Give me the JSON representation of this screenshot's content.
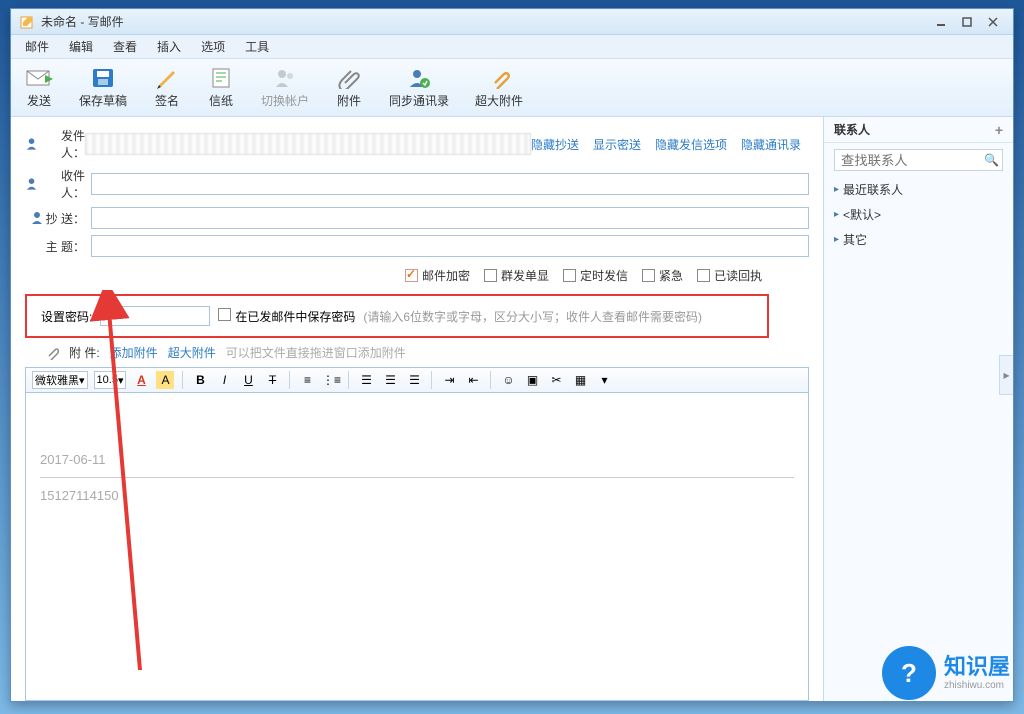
{
  "window": {
    "title": "未命名 - 写邮件"
  },
  "menubar": [
    "邮件",
    "编辑",
    "查看",
    "插入",
    "选项",
    "工具"
  ],
  "toolbar": [
    {
      "key": "send",
      "label": "发送"
    },
    {
      "key": "save_draft",
      "label": "保存草稿"
    },
    {
      "key": "signature",
      "label": "签名"
    },
    {
      "key": "stationery",
      "label": "信纸"
    },
    {
      "key": "switch_account",
      "label": "切换帐户",
      "disabled": true
    },
    {
      "key": "attachment",
      "label": "附件"
    },
    {
      "key": "sync_contacts",
      "label": "同步通讯录"
    },
    {
      "key": "big_attachment",
      "label": "超大附件"
    }
  ],
  "fields": {
    "sender": "发件人：",
    "to": "收件人：",
    "cc": "抄 送：",
    "subject": "主 题："
  },
  "links": {
    "hide_cc": "隐藏抄送",
    "show_bcc": "显示密送",
    "hide_send_opts": "隐藏发信选项",
    "hide_contacts": "隐藏通讯录"
  },
  "options": {
    "encrypt": "邮件加密",
    "mass_reply": "群发单显",
    "scheduled": "定时发信",
    "urgent": "紧急",
    "read_receipt": "已读回执"
  },
  "password": {
    "label": "设置密码:",
    "save_label": "在已发邮件中保存密码",
    "hint": "(请输入6位数字或字母，区分大小写；收件人查看邮件需要密码)"
  },
  "attach": {
    "label": "附 件:",
    "add": "添加附件",
    "big": "超大附件",
    "hint": "可以把文件直接拖进窗口添加附件"
  },
  "editor": {
    "font": "微软雅黑",
    "size": "10.5",
    "body_line1": "2017-06-11",
    "body_line2": "15127114150"
  },
  "sidebar": {
    "title": "联系人",
    "search_placeholder": "查找联系人",
    "items": [
      "最近联系人",
      "<默认>",
      "其它"
    ]
  },
  "watermark": {
    "brand": "知识屋",
    "url": "zhishiwu.com"
  }
}
